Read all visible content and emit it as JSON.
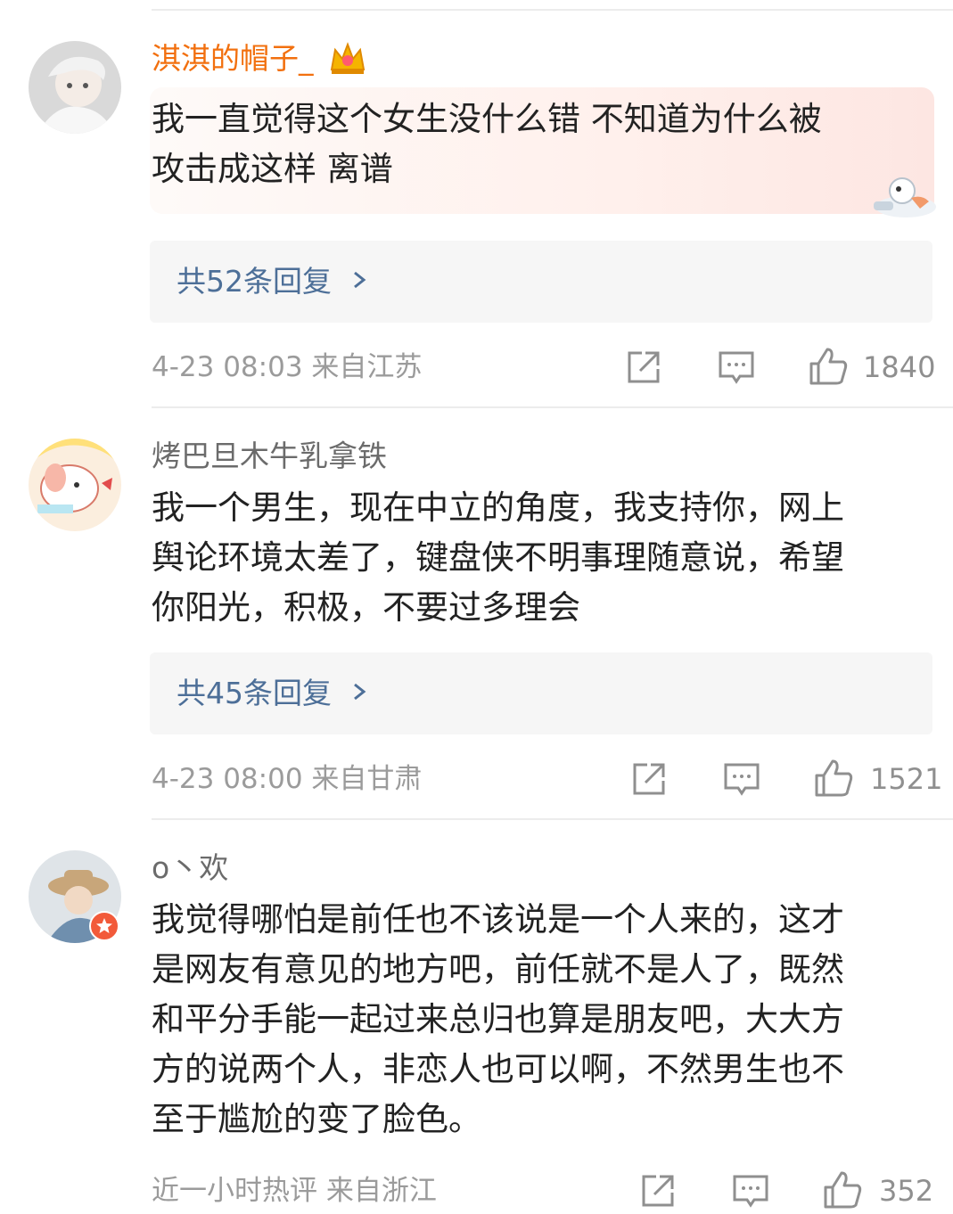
{
  "comments": [
    {
      "username": "淇淇的帽子_",
      "badge_icon": "crown-icon",
      "text": "我一直觉得这个女生没什么错 不知道为什么被\n攻击成这样 离谱",
      "replies_label": "共52条回复",
      "meta": "4-23 08:03  来自江苏",
      "likes": "1840"
    },
    {
      "username": "烤巴旦木牛乳拿铁",
      "text": "我一个男生，现在中立的角度，我支持你，网上\n舆论环境太差了，键盘侠不明事理随意说，希望\n你阳光，积极，不要过多理会",
      "replies_label": "共45条回复",
      "meta": "4-23 08:00  来自甘肃",
      "likes": "1521"
    },
    {
      "username": "o丶欢",
      "text": "我觉得哪怕是前任也不该说是一个人来的，这才\n是网友有意见的地方吧，前任就不是人了，既然\n和平分手能一起过来总归也算是朋友吧，大大方\n方的说两个人，非恋人也可以啊，不然男生也不\n至于尴尬的变了脸色。",
      "meta": "近一小时热评  来自浙江",
      "likes": "352"
    }
  ],
  "colors": {
    "vip_name": "#f2700f",
    "link_blue": "#4d6f98",
    "meta_gray": "#9b9b9b"
  },
  "icons": [
    "share-icon",
    "comment-icon",
    "like-icon",
    "chevron-right-icon"
  ]
}
